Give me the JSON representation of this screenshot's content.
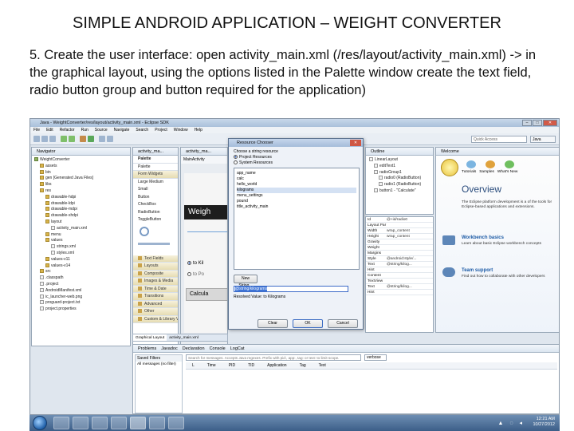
{
  "slide": {
    "title": "SIMPLE ANDROID APPLICATION – WEIGHT CONVERTER",
    "body": "5. Create the user interface: open activity_main.xml (/res/layout/activity_main.xml) -> in the graphical layout, using the options listed in the Palette window create the text field, radio button group and button required for the application)"
  },
  "eclipse": {
    "window_title": "Java - WeightConverter/res/layout/activity_main.xml - Eclipse SDK",
    "menu": [
      "File",
      "Edit",
      "Refactor",
      "Run",
      "Source",
      "Navigate",
      "Search",
      "Project",
      "Window",
      "Help"
    ],
    "quick_access": "Quick Access",
    "perspective": "Java",
    "navigator": {
      "tab": "Navigator",
      "items": [
        "WeightConverter",
        "assets",
        "bin",
        "gen [Generated Java Files]",
        "libs",
        "res",
        "drawable-hdpi",
        "drawable-ldpi",
        "drawable-mdpi",
        "drawable-xhdpi",
        "layout",
        "activity_main.xml",
        "menu",
        "values",
        "strings.xml",
        "styles.xml",
        "values-v11",
        "values-v14",
        "src",
        ".classpath",
        ".project",
        "AndroidManifest.xml",
        "ic_launcher-web.png",
        "proguard-project.txt",
        "project.properties"
      ]
    },
    "editor_tabs": [
      "activity_ma...",
      "activity_ma...",
      "activity_ma..."
    ],
    "palette": {
      "title": "Palette",
      "search": "Palette",
      "sections": [
        "Form Widgets",
        "Text Fields",
        "Layouts",
        "Composite",
        "Images & Media",
        "Time & Date",
        "Transitions",
        "Advanced",
        "Other",
        "Custom & Library Views"
      ],
      "widgets": [
        "Large Medium",
        "Small",
        "Button",
        "CheckBox",
        "RadioButton",
        "ToggleButton"
      ]
    },
    "editor": {
      "toolbar_item": "MainActivity",
      "app_title": "Weigh",
      "radio_1": "to Kil",
      "radio_2": "to Po",
      "button": "Calcula",
      "bottom_tabs": [
        "Graphical Layout",
        "activity_main.xml"
      ]
    },
    "dialog": {
      "title": "Resource Chooser",
      "label": "Choose a string resource",
      "options": [
        "Project Resources",
        "System Resources"
      ],
      "resources": [
        "app_name",
        "calc",
        "hello_world",
        "kilograms",
        "menu_settings",
        "pound",
        "title_activity_main"
      ],
      "new_string_button": "New String...",
      "input_value": "@string/kilograms",
      "resolved_label": "Resolved Value: to Kilograms",
      "buttons": [
        "Clear",
        "OK",
        "Cancel"
      ]
    },
    "outline": {
      "tab": "Outline",
      "items": [
        "LinearLayout",
        "editText1",
        "radioGroup1",
        "radio0 (RadioButton)",
        "radio1 (RadioButton)",
        "button1 - \"Calculate\""
      ]
    },
    "properties": {
      "rows": [
        {
          "k": "Id",
          "v": "@+id/radio0"
        },
        {
          "k": "Layout Par",
          "v": ""
        },
        {
          "k": "Width",
          "v": "wrap_content"
        },
        {
          "k": "Height",
          "v": "wrap_content"
        },
        {
          "k": "Gravity",
          "v": ""
        },
        {
          "k": "Weight",
          "v": ""
        },
        {
          "k": "Margins",
          "v": ""
        },
        {
          "k": "Style",
          "v": "@android:style/..."
        },
        {
          "k": "Text",
          "v": "@string/kilog..."
        },
        {
          "k": "Hint",
          "v": ""
        },
        {
          "k": "Content",
          "v": ""
        },
        {
          "k": "TextView",
          "v": ""
        },
        {
          "k": "Text",
          "v": "@string/kilog..."
        },
        {
          "k": "Hint",
          "v": ""
        }
      ]
    },
    "welcome": {
      "tab": "Welcome",
      "nav": [
        "Tutorials",
        "Samples",
        "What's New"
      ],
      "heading": "Overview",
      "intro": "The Eclipse platform development is a of the tools for Eclipse-based applications and extensions.",
      "links": [
        {
          "title": "Workbench basics",
          "desc": "Learn about basic Eclipse workbench concepts"
        },
        {
          "title": "Team support",
          "desc": "Find out how to collaborate with other developers"
        }
      ]
    },
    "logcat": {
      "tabs": [
        "Problems",
        "Javadoc",
        "Declaration",
        "Console",
        "LogCat"
      ],
      "filters_title": "Saved Filters",
      "filter_item": "All messages (no filter)",
      "search_placeholder": "Search for messages. Accepts Java regexes. Prefix with pid:, app:, tag: or text: to limit scope.",
      "level": "verbose",
      "columns": [
        "L",
        "Time",
        "PID",
        "TID",
        "Application",
        "Tag",
        "Text"
      ]
    },
    "taskbar": {
      "time": "12:21 AM",
      "date": "10/27/2012"
    }
  }
}
